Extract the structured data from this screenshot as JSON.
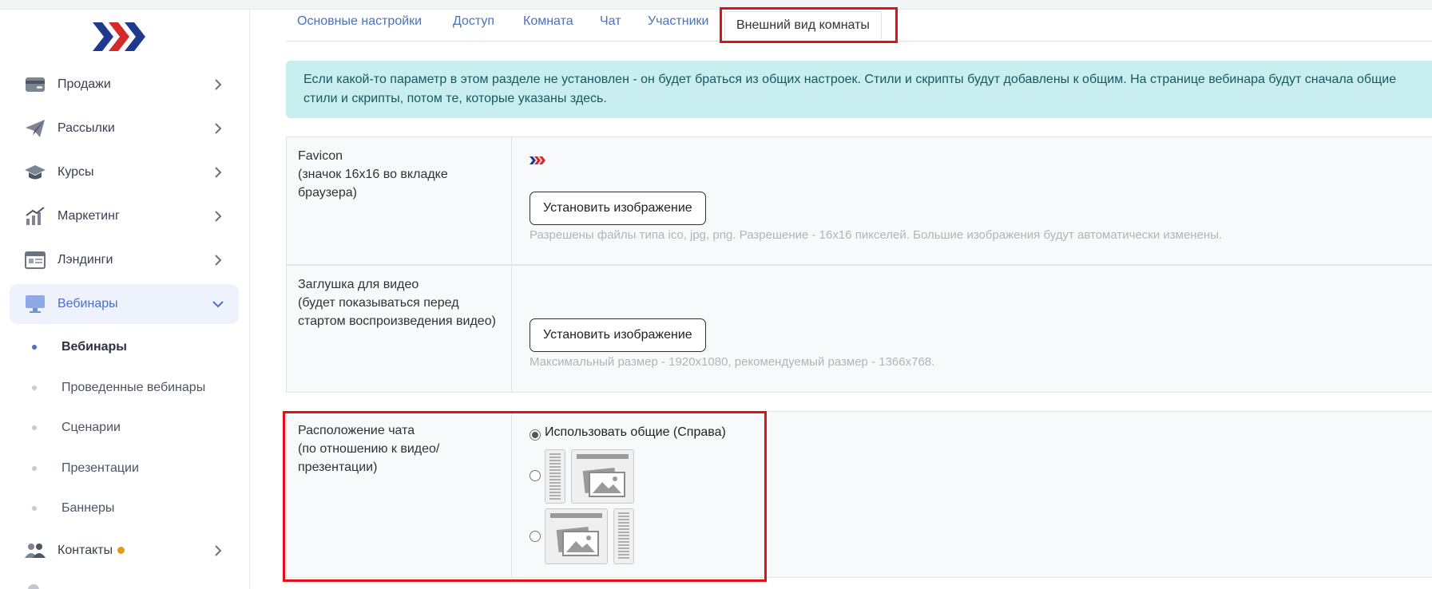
{
  "sidebar": {
    "menu": [
      {
        "label": "Продажи",
        "icon": "wallet-icon"
      },
      {
        "label": "Рассылки",
        "icon": "paper-plane-icon"
      },
      {
        "label": "Курсы",
        "icon": "graduation-cap-icon"
      },
      {
        "label": "Маркетинг",
        "icon": "growth-chart-icon"
      },
      {
        "label": "Лэндинги",
        "icon": "landing-page-icon"
      },
      {
        "label": "Вебинары",
        "icon": "monitor-icon"
      },
      {
        "label": "Контакты",
        "icon": "users-icon"
      }
    ],
    "webinar_sub": [
      {
        "label": "Вебинары"
      },
      {
        "label": "Проведенные вебинары"
      },
      {
        "label": "Сценарии"
      },
      {
        "label": "Презентации"
      },
      {
        "label": "Баннеры"
      }
    ]
  },
  "tabs": [
    {
      "label": "Основные настройки"
    },
    {
      "label": "Доступ"
    },
    {
      "label": "Комната"
    },
    {
      "label": "Чат"
    },
    {
      "label": "Участники"
    },
    {
      "label": "Внешний вид комнаты"
    }
  ],
  "alert": {
    "text": "Если какой-то параметр в этом разделе не установлен - он будет браться из общих настроек. Стили и скрипты будут добавлены к общим. На странице вебинара будут сначала общие стили и скрипты, потом те, которые указаны здесь."
  },
  "favicon": {
    "label": "Favicon\n(значок 16x16 во вкладке браузера)",
    "button": "Установить изображение",
    "hint": "Разрешены файлы типа ico, jpg, png. Разрешение - 16x16 пикселей. Большие изображения будут автоматически изменены."
  },
  "video_placeholder": {
    "label": "Заглушка для видео\n(будет показываться перед стартом воспроизведения видео)",
    "button": "Установить изображение",
    "hint": "Максимальный размер - 1920x1080, рекомендуемый размер - 1366x768."
  },
  "chat_position": {
    "label": "Расположение чата\n(по отношению к видео/\nпрезентации)",
    "option_default": "Использовать общие (Справа)"
  },
  "colors": {
    "accent": "#4a6ec9",
    "highlight": "#e01218",
    "alert_bg": "#c8eef0",
    "logo_blue": "#1f3a8a",
    "logo_red": "#d42a2a"
  }
}
